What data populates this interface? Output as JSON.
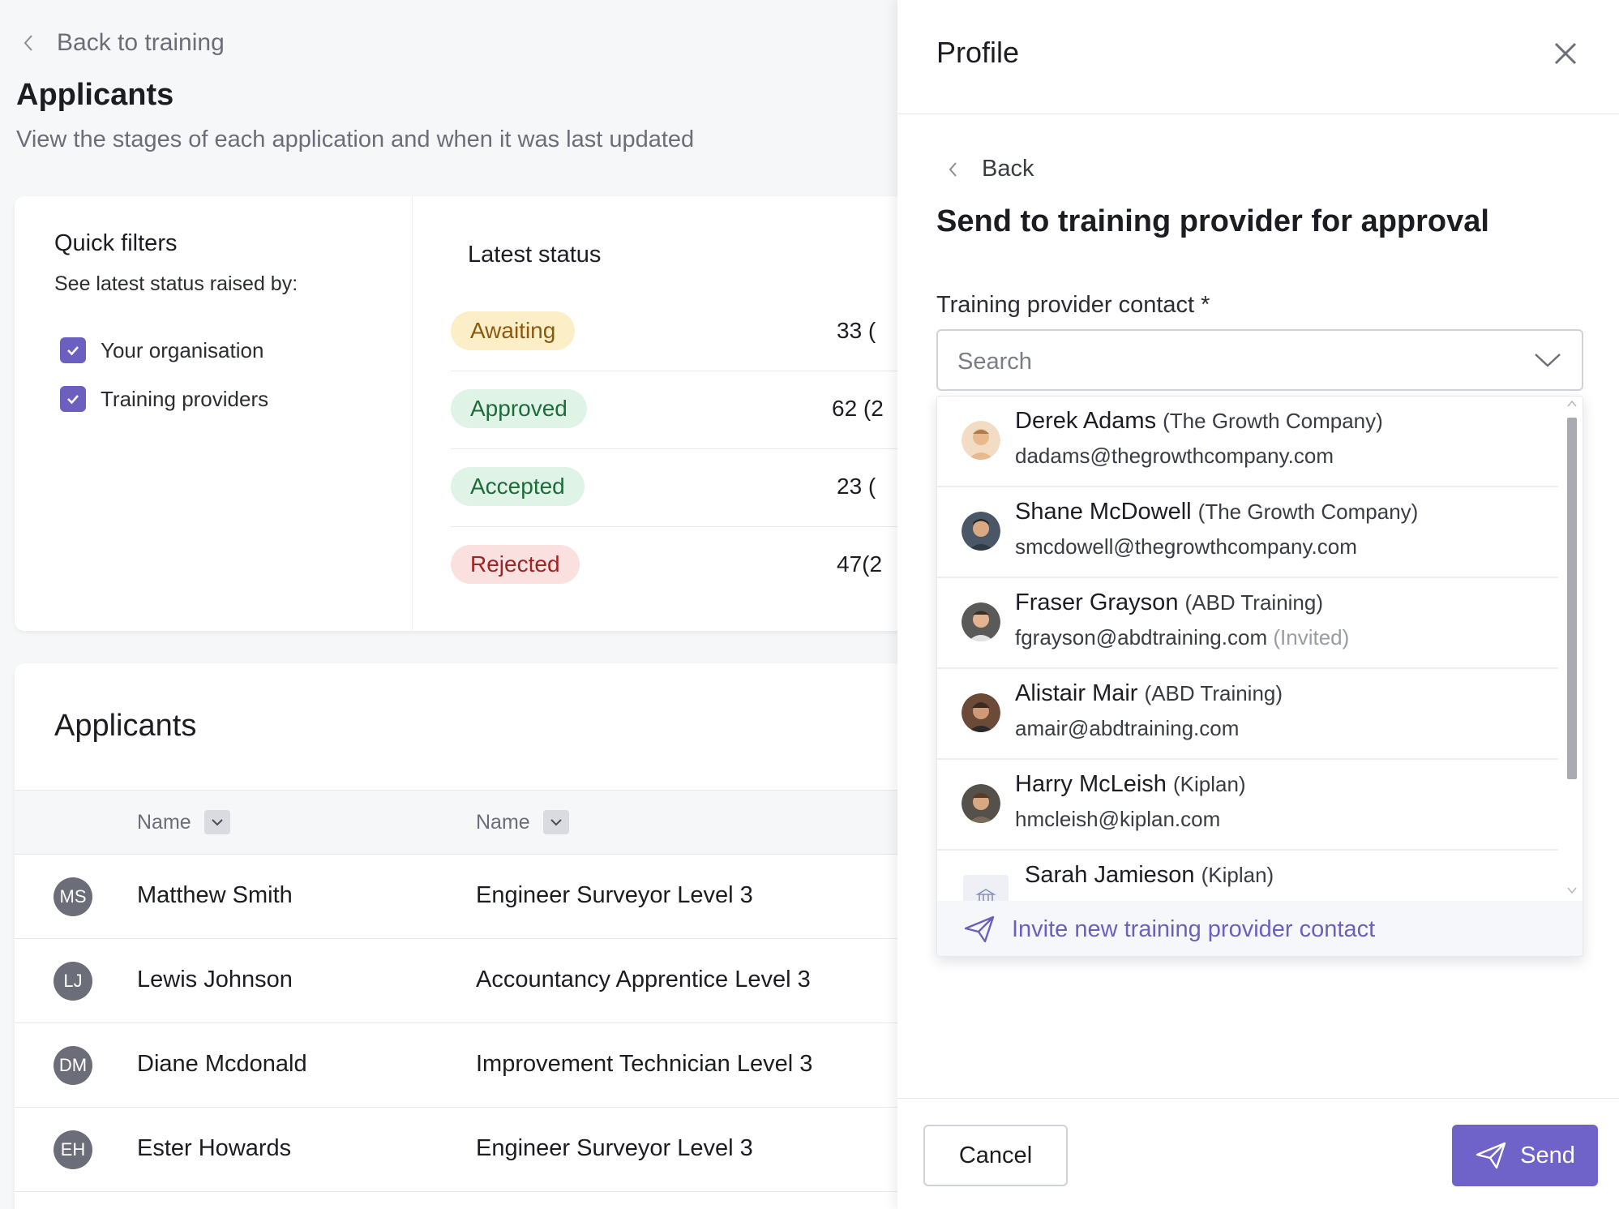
{
  "page": {
    "back_label": "Back to training",
    "title": "Applicants",
    "subtitle": "View the stages of each application and when it was last updated"
  },
  "quick_filters": {
    "title": "Quick filters",
    "subtitle": "See latest status raised by:",
    "options": [
      {
        "label": "Your organisation",
        "checked": true
      },
      {
        "label": "Training providers",
        "checked": true
      }
    ]
  },
  "latest_status": {
    "title": "Latest status",
    "rows": [
      {
        "label": "Awaiting",
        "count": "33 ("
      },
      {
        "label": "Approved",
        "count": "62 (2"
      },
      {
        "label": "Accepted",
        "count": "23 ("
      },
      {
        "label": "Rejected",
        "count": "47(2"
      }
    ]
  },
  "applicants": {
    "title": "Applicants",
    "columns": [
      "Name",
      "Name"
    ],
    "rows": [
      {
        "initials": "MS",
        "name": "Matthew Smith",
        "course": "Engineer Surveyor Level 3"
      },
      {
        "initials": "LJ",
        "name": "Lewis Johnson",
        "course": "Accountancy Apprentice Level 3"
      },
      {
        "initials": "DM",
        "name": "Diane Mcdonald",
        "course": "Improvement Technician Level 3"
      },
      {
        "initials": "EH",
        "name": "Ester Howards",
        "course": "Engineer Surveyor Level 3"
      }
    ]
  },
  "panel": {
    "title": "Profile",
    "back_label": "Back",
    "heading": "Send to training provider for approval",
    "field_label": "Training provider contact *",
    "search_placeholder": "Search",
    "contacts": [
      {
        "name": "Derek Adams",
        "org": "(The Growth Company)",
        "email": "dadams@thegrowthcompany.com",
        "note": ""
      },
      {
        "name": "Shane McDowell",
        "org": "(The Growth Company)",
        "email": "smcdowell@thegrowthcompany.com",
        "note": ""
      },
      {
        "name": "Fraser Grayson",
        "org": "(ABD Training)",
        "email": "fgrayson@abdtraining.com",
        "note": "(Invited)"
      },
      {
        "name": "Alistair Mair",
        "org": "(ABD Training)",
        "email": "amair@abdtraining.com",
        "note": ""
      },
      {
        "name": "Harry McLeish",
        "org": "(Kiplan)",
        "email": "hmcleish@kiplan.com",
        "note": ""
      },
      {
        "name": "Sarah Jamieson",
        "org": "(Kiplan)",
        "email": "",
        "note": ""
      }
    ],
    "invite_label": "Invite new training provider contact",
    "cancel_label": "Cancel",
    "send_label": "Send"
  },
  "colors": {
    "accent": "#6f63c9",
    "checkbox": "#6b5fbf",
    "awaiting_bg": "#fcefc7",
    "approved_bg": "#dff3e6",
    "rejected_bg": "#fbe0e0"
  }
}
